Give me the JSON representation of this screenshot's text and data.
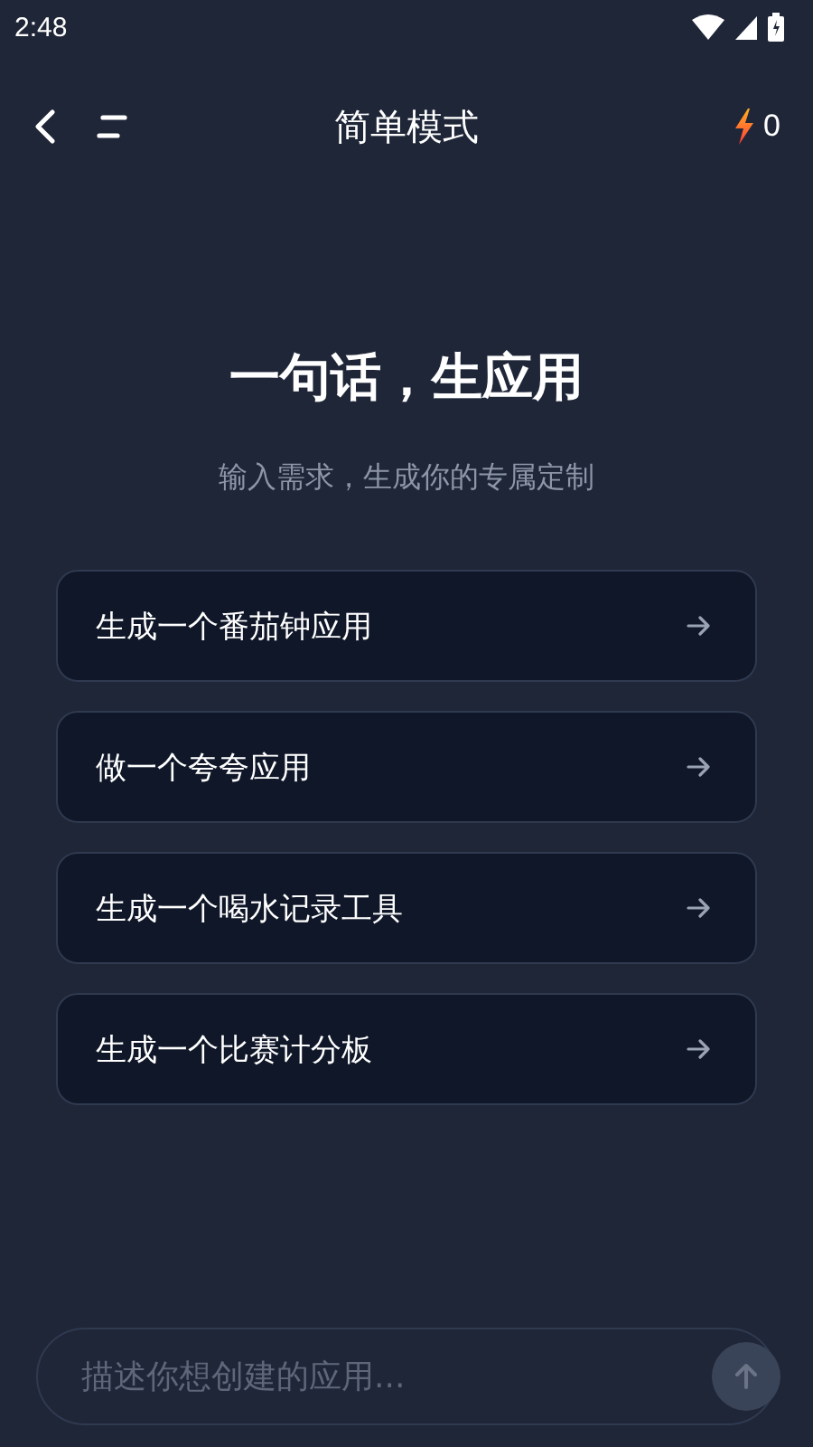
{
  "status_bar": {
    "time": "2:48"
  },
  "header": {
    "title": "简单模式",
    "energy": "0"
  },
  "hero": {
    "title": "一句话，生应用",
    "subtitle": "输入需求，生成你的专属定制"
  },
  "suggestions": [
    {
      "label": "生成一个番茄钟应用"
    },
    {
      "label": "做一个夸夸应用"
    },
    {
      "label": "生成一个喝水记录工具"
    },
    {
      "label": "生成一个比赛计分板"
    }
  ],
  "composer": {
    "placeholder": "描述你想创建的应用..."
  }
}
